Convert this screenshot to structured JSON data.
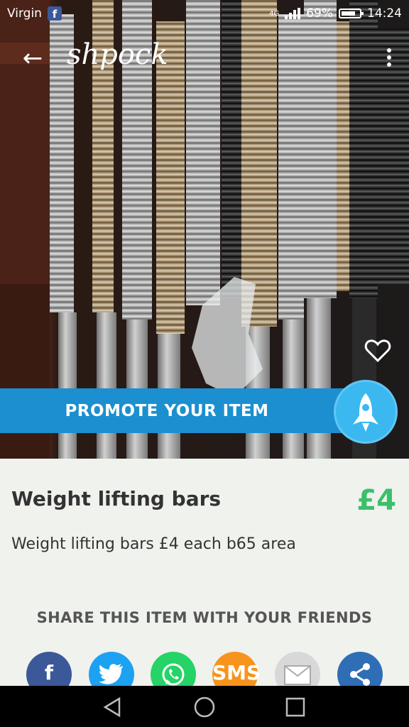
{
  "status_bar": {
    "carrier": "Virgin",
    "network": "4G",
    "battery": "69%",
    "time": "14:24"
  },
  "toolbar": {
    "logo": "shpock"
  },
  "listing": {
    "promote_label": "PROMOTE YOUR ITEM",
    "title": "Weight lifting bars",
    "price": "£4",
    "description": "Weight lifting bars £4 each b65 area"
  },
  "share": {
    "heading": "SHARE THIS ITEM WITH YOUR FRIENDS",
    "sms_label": "SMS",
    "colors": {
      "facebook": "#3b5998",
      "twitter": "#1da1f2",
      "whatsapp": "#25d366",
      "sms": "#f7941d",
      "email": "#d8d8d8",
      "share": "#2f6db5"
    }
  },
  "icons": [
    "back-arrow-icon",
    "more-vert-icon",
    "heart-icon",
    "rocket-icon",
    "facebook-icon",
    "twitter-icon",
    "whatsapp-icon",
    "email-icon",
    "share-icon",
    "nav-back-icon",
    "nav-home-icon",
    "nav-recents-icon"
  ]
}
